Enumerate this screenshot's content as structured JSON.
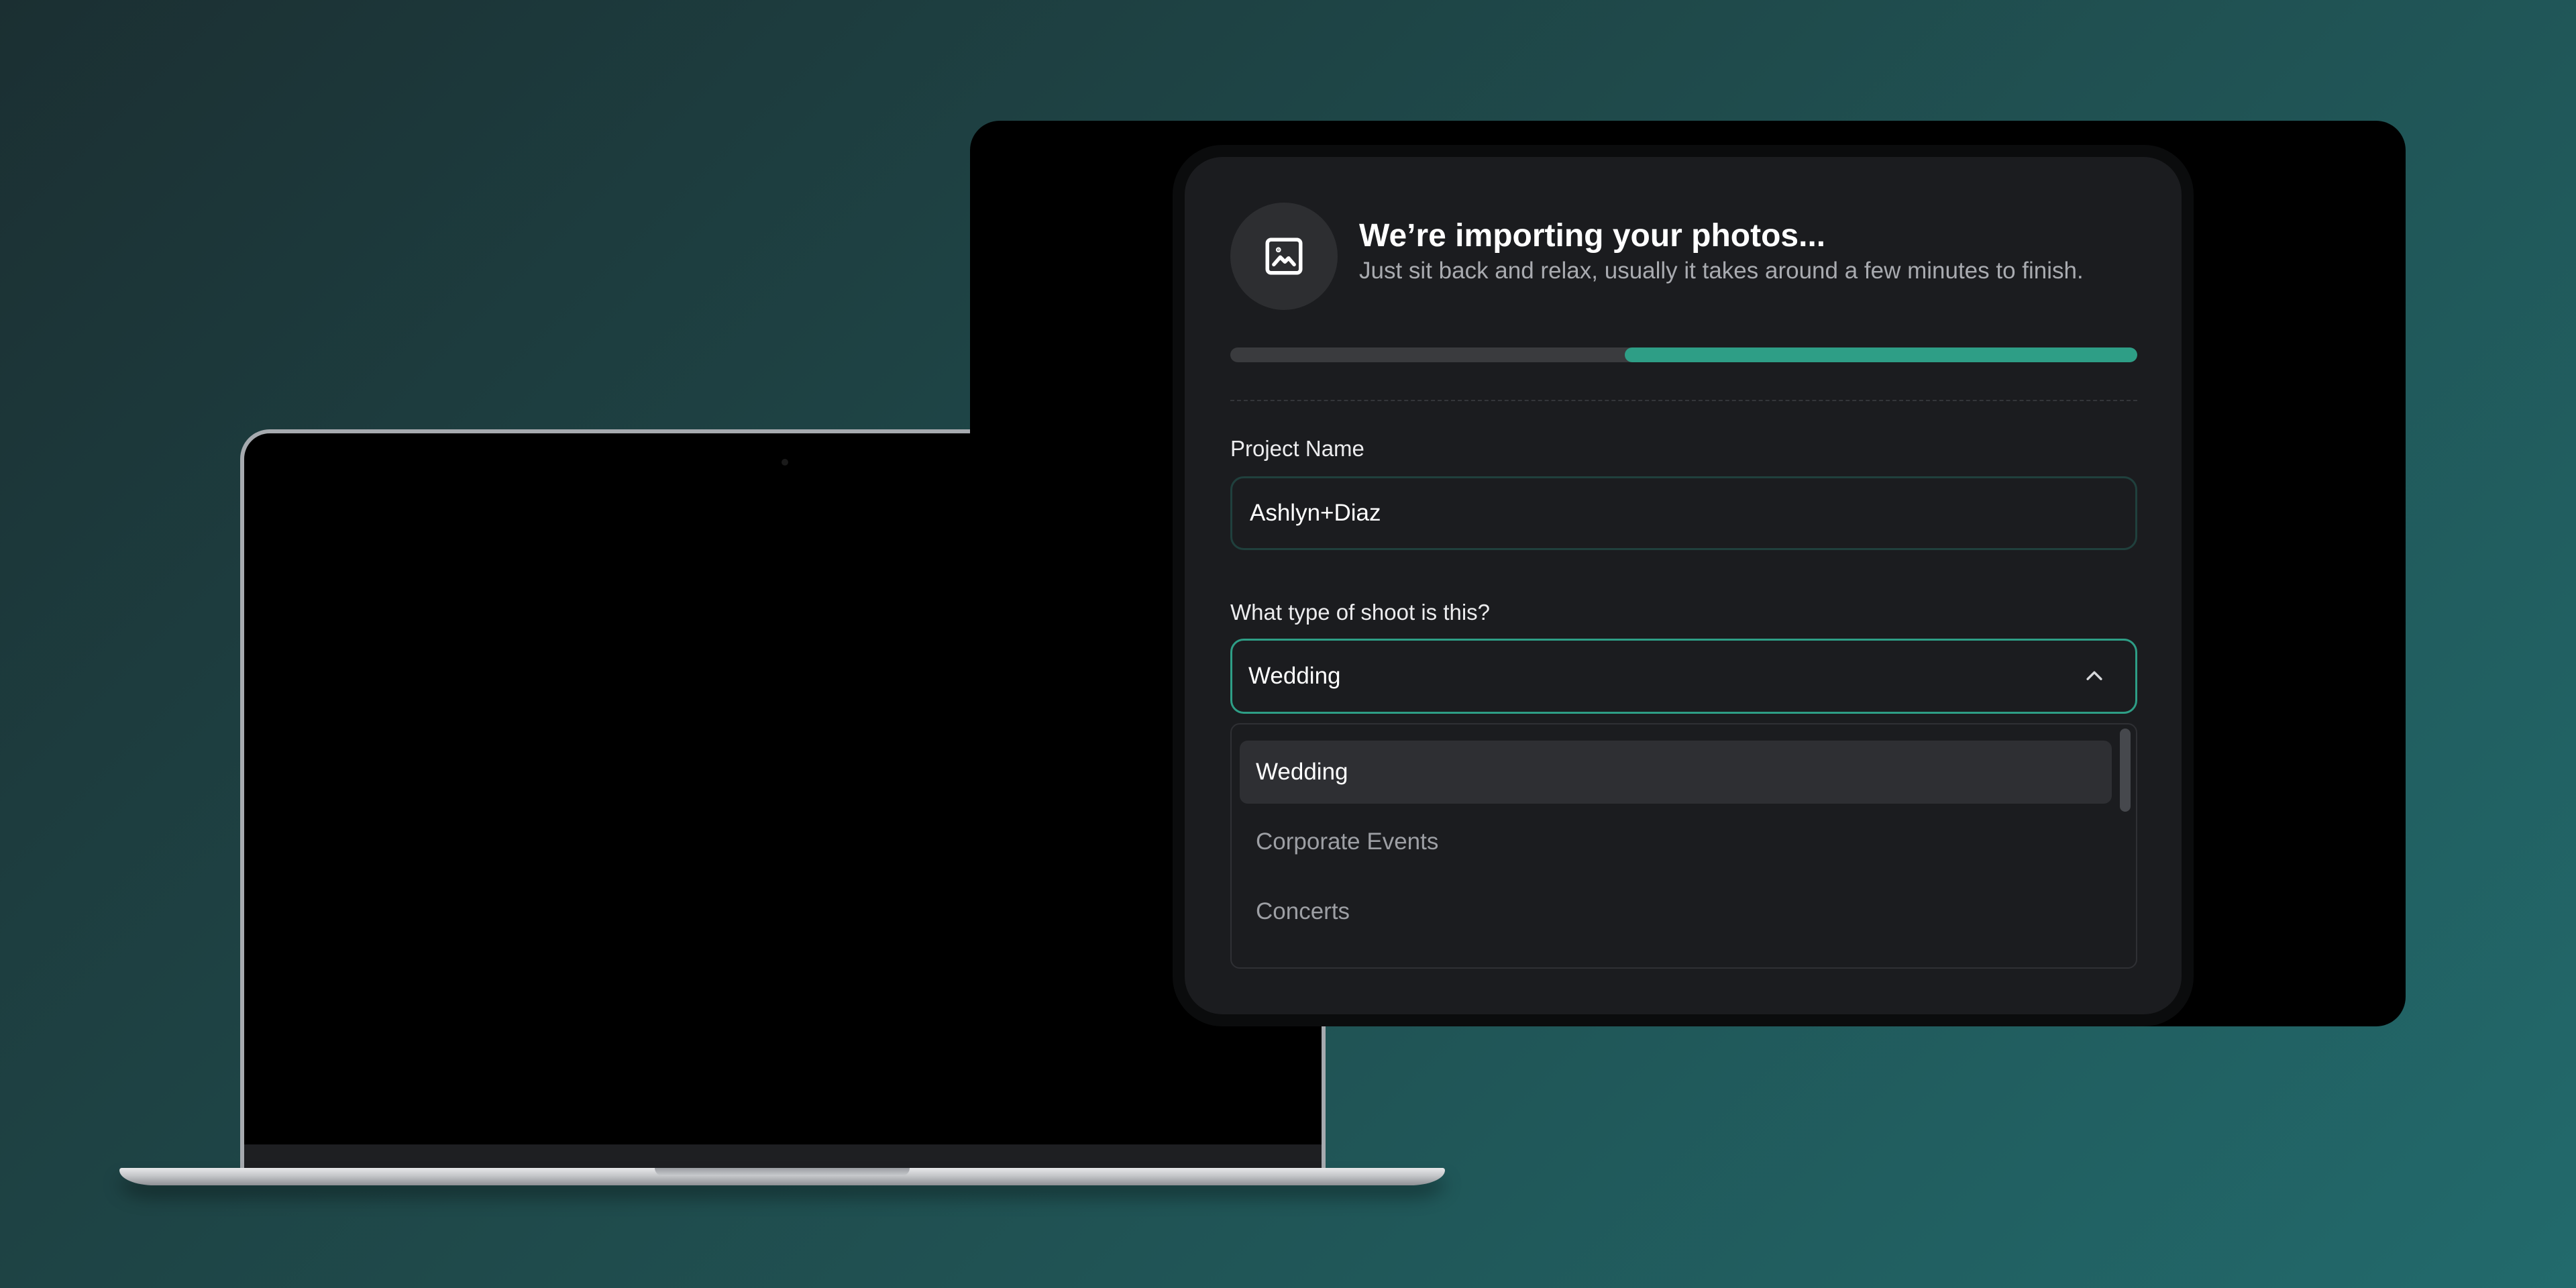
{
  "header": {
    "icon": "image-icon",
    "title": "We’re importing your photos...",
    "subtitle": "Just sit back and relax, usually it takes around a few minutes to finish."
  },
  "progress": {
    "percent": 56.5,
    "fill_color": "#2e9e86",
    "track_color": "#3a3b3e"
  },
  "project": {
    "label": "Project Name",
    "value": "Ashlyn+Diaz"
  },
  "shoot_type": {
    "label": "What type of shoot is this?",
    "selected": "Wedding",
    "options": [
      "Wedding",
      "Corporate Events",
      "Concerts"
    ]
  },
  "colors": {
    "accent": "#2e9e86",
    "card_background": "#1b1c1f"
  }
}
